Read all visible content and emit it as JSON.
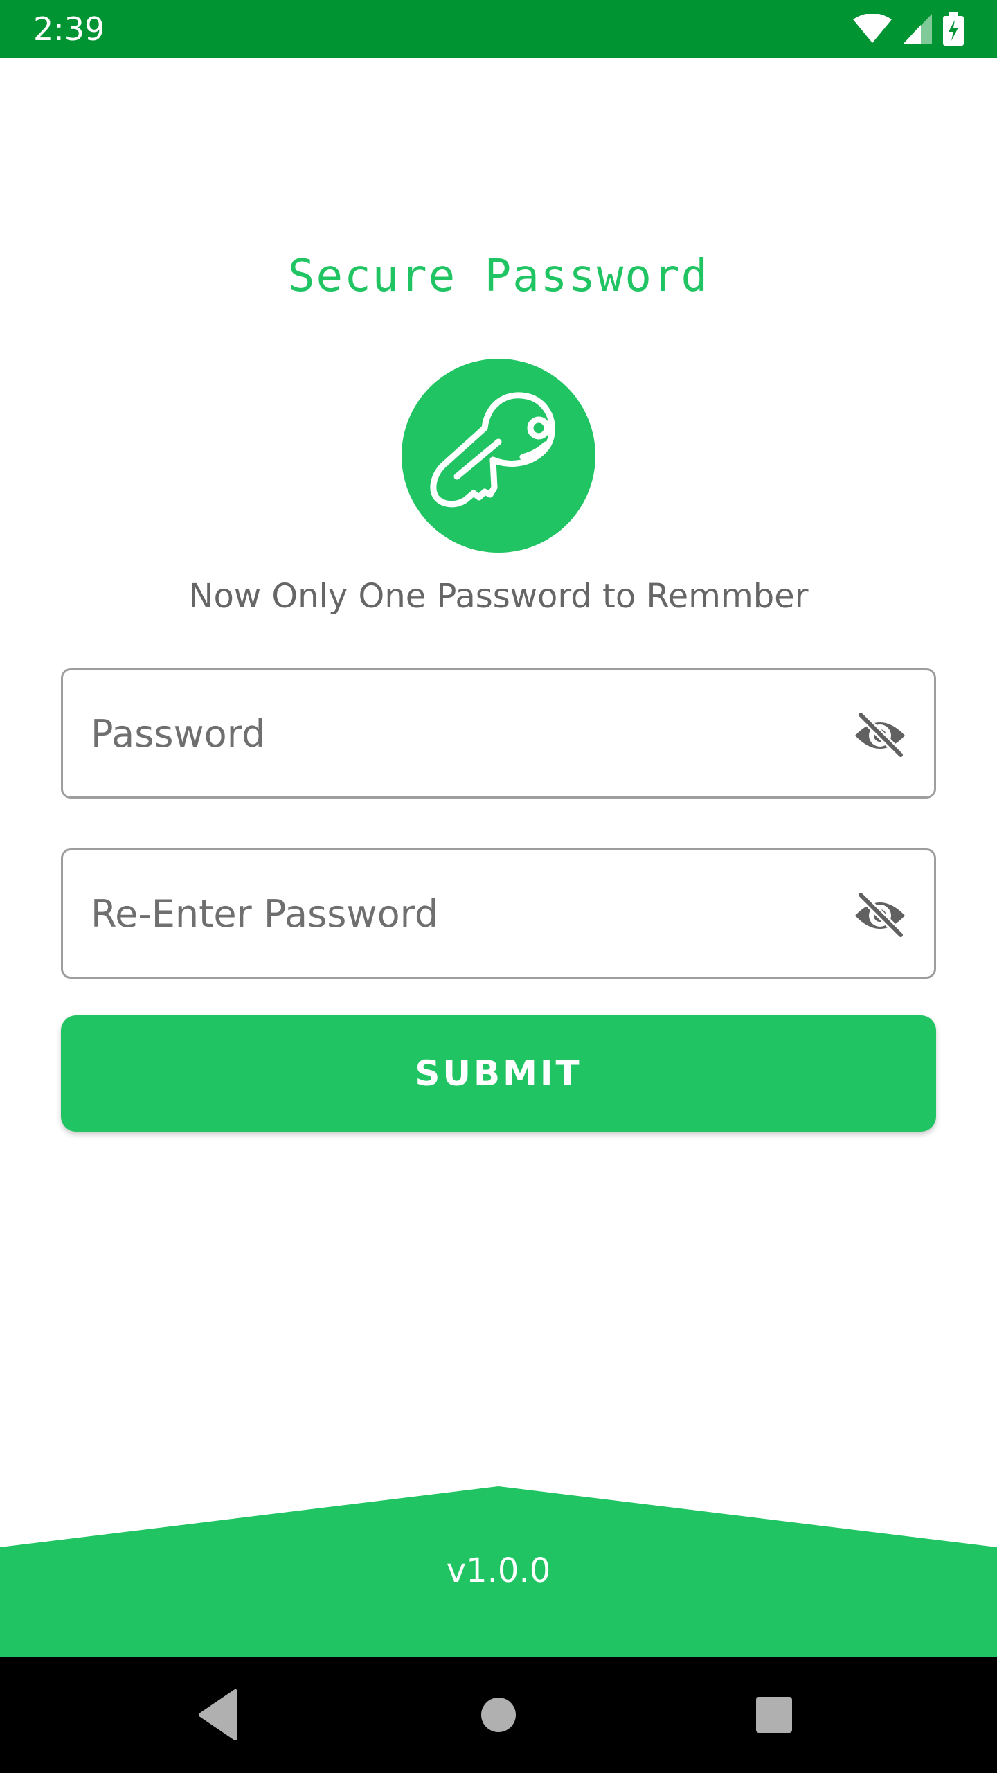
{
  "status_bar": {
    "time": "2:39",
    "icons": [
      "wifi-icon",
      "cell-signal-icon",
      "battery-charging-icon"
    ],
    "background": "#009432"
  },
  "header": {
    "title": "Secure Password",
    "logo_icon": "key-icon",
    "subtitle": "Now Only One Password to Remmber"
  },
  "form": {
    "password": {
      "placeholder": "Password",
      "value": "",
      "toggle_icon": "eye-off-icon"
    },
    "confirm_password": {
      "placeholder": "Re-Enter Password",
      "value": "",
      "toggle_icon": "eye-off-icon"
    },
    "submit_label": "SUBMIT"
  },
  "footer": {
    "version": "v1.0.0"
  },
  "nav_bar": {
    "buttons": [
      "back-icon",
      "home-icon",
      "recents-icon"
    ]
  },
  "colors": {
    "accent": "#20c462",
    "status_bar": "#009432",
    "field_border": "#9e9e9e",
    "subtitle_text": "#666666"
  }
}
